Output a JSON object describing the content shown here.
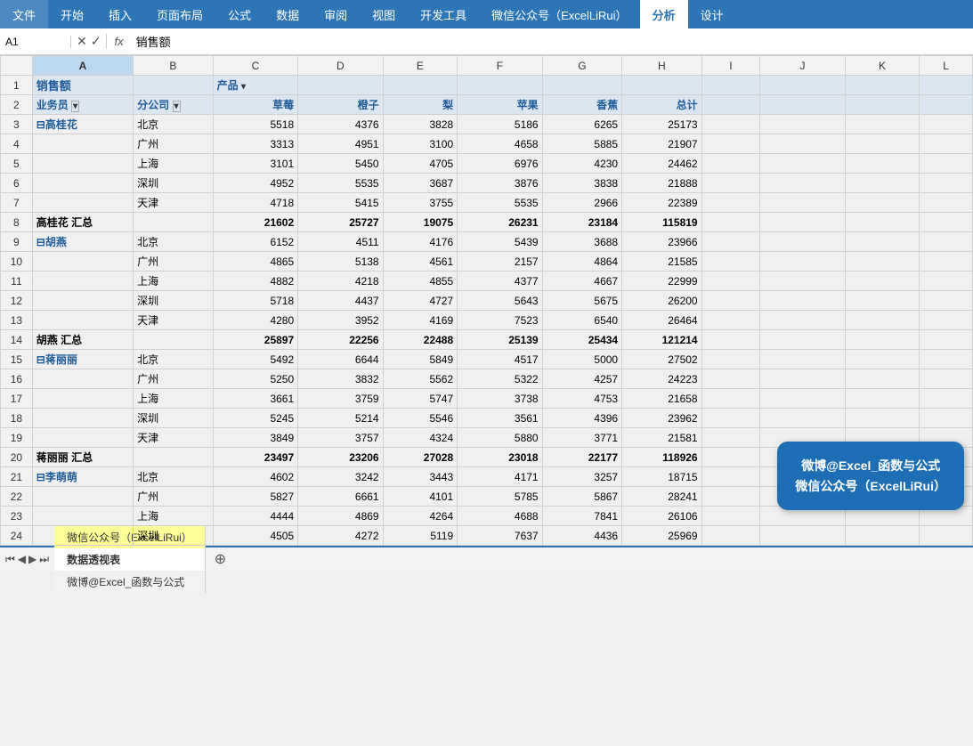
{
  "ribbon": {
    "tabs": [
      "文件",
      "开始",
      "插入",
      "页面布局",
      "公式",
      "数据",
      "审阅",
      "视图",
      "开发工具",
      "微信公众号（ExcelLiRui）",
      "分析",
      "设计"
    ],
    "active": "分析"
  },
  "formulaBar": {
    "nameBox": "A1",
    "formulaText": "销售额"
  },
  "columns": {
    "letters": [
      "",
      "A",
      "B",
      "C",
      "D",
      "E",
      "F",
      "G",
      "H",
      "I",
      "J",
      "K",
      "L"
    ],
    "widths": [
      30,
      95,
      75,
      80,
      80,
      70,
      80,
      75,
      75,
      55,
      80,
      70,
      50
    ]
  },
  "rows": [
    {
      "rn": 1,
      "a": "销售额",
      "b": "",
      "c": "产品",
      "d": "",
      "e": "",
      "f": "",
      "g": "",
      "h": "",
      "i": "",
      "j": "",
      "k": "",
      "l": ""
    },
    {
      "rn": 2,
      "a": "业务员",
      "b": "分公司",
      "c": "草莓",
      "d": "橙子",
      "e": "梨",
      "f": "苹果",
      "g": "香蕉",
      "h": "总计",
      "i": "",
      "j": "",
      "k": "",
      "l": ""
    },
    {
      "rn": 3,
      "a": "⊟高桂花",
      "b": "北京",
      "c": "5518",
      "d": "4376",
      "e": "3828",
      "f": "5186",
      "g": "6265",
      "h": "25173",
      "i": "",
      "j": "",
      "k": "",
      "l": ""
    },
    {
      "rn": 4,
      "a": "",
      "b": "广州",
      "c": "3313",
      "d": "4951",
      "e": "3100",
      "f": "4658",
      "g": "5885",
      "h": "21907",
      "i": "",
      "j": "",
      "k": "",
      "l": ""
    },
    {
      "rn": 5,
      "a": "",
      "b": "上海",
      "c": "3101",
      "d": "5450",
      "e": "4705",
      "f": "6976",
      "g": "4230",
      "h": "24462",
      "i": "",
      "j": "",
      "k": "",
      "l": ""
    },
    {
      "rn": 6,
      "a": "",
      "b": "深圳",
      "c": "4952",
      "d": "5535",
      "e": "3687",
      "f": "3876",
      "g": "3838",
      "h": "21888",
      "i": "",
      "j": "",
      "k": "",
      "l": ""
    },
    {
      "rn": 7,
      "a": "",
      "b": "天津",
      "c": "4718",
      "d": "5415",
      "e": "3755",
      "f": "5535",
      "g": "2966",
      "h": "22389",
      "i": "",
      "j": "",
      "k": "",
      "l": ""
    },
    {
      "rn": 8,
      "a": "高桂花 汇总",
      "b": "",
      "c": "21602",
      "d": "25727",
      "e": "19075",
      "f": "26231",
      "g": "23184",
      "h": "115819",
      "i": "",
      "j": "",
      "k": "",
      "l": ""
    },
    {
      "rn": 9,
      "a": "⊟胡燕",
      "b": "北京",
      "c": "6152",
      "d": "4511",
      "e": "4176",
      "f": "5439",
      "g": "3688",
      "h": "23966",
      "i": "",
      "j": "",
      "k": "",
      "l": ""
    },
    {
      "rn": 10,
      "a": "",
      "b": "广州",
      "c": "4865",
      "d": "5138",
      "e": "4561",
      "f": "2157",
      "g": "4864",
      "h": "21585",
      "i": "",
      "j": "",
      "k": "",
      "l": ""
    },
    {
      "rn": 11,
      "a": "",
      "b": "上海",
      "c": "4882",
      "d": "4218",
      "e": "4855",
      "f": "4377",
      "g": "4667",
      "h": "22999",
      "i": "",
      "j": "",
      "k": "",
      "l": ""
    },
    {
      "rn": 12,
      "a": "",
      "b": "深圳",
      "c": "5718",
      "d": "4437",
      "e": "4727",
      "f": "5643",
      "g": "5675",
      "h": "26200",
      "i": "",
      "j": "",
      "k": "",
      "l": ""
    },
    {
      "rn": 13,
      "a": "",
      "b": "天津",
      "c": "4280",
      "d": "3952",
      "e": "4169",
      "f": "7523",
      "g": "6540",
      "h": "26464",
      "i": "",
      "j": "",
      "k": "",
      "l": ""
    },
    {
      "rn": 14,
      "a": "胡燕 汇总",
      "b": "",
      "c": "25897",
      "d": "22256",
      "e": "22488",
      "f": "25139",
      "g": "25434",
      "h": "121214",
      "i": "",
      "j": "",
      "k": "",
      "l": ""
    },
    {
      "rn": 15,
      "a": "⊟蒋丽丽",
      "b": "北京",
      "c": "5492",
      "d": "6644",
      "e": "5849",
      "f": "4517",
      "g": "5000",
      "h": "27502",
      "i": "",
      "j": "",
      "k": "",
      "l": ""
    },
    {
      "rn": 16,
      "a": "",
      "b": "广州",
      "c": "5250",
      "d": "3832",
      "e": "5562",
      "f": "5322",
      "g": "4257",
      "h": "24223",
      "i": "",
      "j": "",
      "k": "",
      "l": ""
    },
    {
      "rn": 17,
      "a": "",
      "b": "上海",
      "c": "3661",
      "d": "3759",
      "e": "5747",
      "f": "3738",
      "g": "4753",
      "h": "21658",
      "i": "",
      "j": "",
      "k": "",
      "l": ""
    },
    {
      "rn": 18,
      "a": "",
      "b": "深圳",
      "c": "5245",
      "d": "5214",
      "e": "5546",
      "f": "3561",
      "g": "4396",
      "h": "23962",
      "i": "",
      "j": "",
      "k": "",
      "l": ""
    },
    {
      "rn": 19,
      "a": "",
      "b": "天津",
      "c": "3849",
      "d": "3757",
      "e": "4324",
      "f": "5880",
      "g": "3771",
      "h": "21581",
      "i": "",
      "j": "",
      "k": "",
      "l": ""
    },
    {
      "rn": 20,
      "a": "蒋丽丽 汇总",
      "b": "",
      "c": "23497",
      "d": "23206",
      "e": "27028",
      "f": "23018",
      "g": "22177",
      "h": "118926",
      "i": "",
      "j": "",
      "k": "",
      "l": ""
    },
    {
      "rn": 21,
      "a": "⊟李萌萌",
      "b": "北京",
      "c": "4602",
      "d": "3242",
      "e": "3443",
      "f": "4171",
      "g": "3257",
      "h": "18715",
      "i": "",
      "j": "",
      "k": "",
      "l": ""
    },
    {
      "rn": 22,
      "a": "",
      "b": "广州",
      "c": "5827",
      "d": "6661",
      "e": "4101",
      "f": "5785",
      "g": "5867",
      "h": "28241",
      "i": "",
      "j": "",
      "k": "",
      "l": ""
    },
    {
      "rn": 23,
      "a": "",
      "b": "上海",
      "c": "4444",
      "d": "4869",
      "e": "4264",
      "f": "4688",
      "g": "7841",
      "h": "26106",
      "i": "",
      "j": "",
      "k": "",
      "l": ""
    },
    {
      "rn": 24,
      "a": "",
      "b": "深圳",
      "c": "4505",
      "d": "4272",
      "e": "5119",
      "f": "7637",
      "g": "4436",
      "h": "25969",
      "i": "",
      "j": "",
      "k": "",
      "l": ""
    }
  ],
  "subtotalRows": [
    8,
    14,
    20
  ],
  "headerRows": [
    1,
    2
  ],
  "sheetTabs": [
    {
      "label": "微信公众号（ExcelLiRui）",
      "active": false,
      "yellow": true
    },
    {
      "label": "数据透视表",
      "active": true,
      "yellow": false
    },
    {
      "label": "微博@Excel_函数与公式",
      "active": false,
      "yellow": false
    }
  ],
  "watermark": {
    "line1": "微博@Excel_函数与公式",
    "line2": "微信公众号（ExcelLiRui）"
  }
}
